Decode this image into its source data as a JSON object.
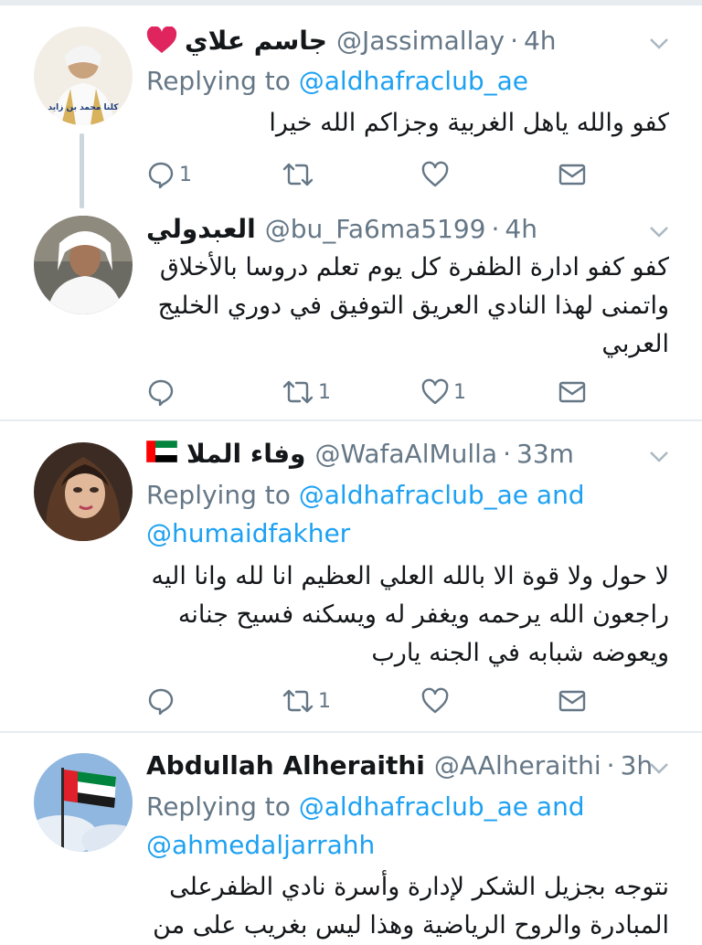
{
  "tweets": [
    {
      "name": "جاسم علاي",
      "handle": "@Jassimallay",
      "time": "4h",
      "reply_prefix": "Replying to",
      "reply_to": "@aldhafraclub_ae",
      "text": "كفو والله ياهل الغربية وجزاكم الله خيرا",
      "counts": {
        "reply": "1",
        "retweet": "",
        "like": ""
      },
      "avatar_caption": "كلنا محمد بن زايد"
    },
    {
      "name": "العبدولي",
      "handle": "@bu_Fa6ma5199",
      "time": "4h",
      "text": "كفو كفو ادارة الظفرة كل يوم تعلم دروسا بالأخلاق واتمنى لهذا النادي العريق التوفيق في دوري الخليج العربي",
      "counts": {
        "reply": "",
        "retweet": "1",
        "like": "1"
      }
    },
    {
      "name": "وفاء الملا",
      "handle": "@WafaAlMulla",
      "time": "33m",
      "reply_prefix": "Replying to",
      "reply_to": "@aldhafraclub_ae",
      "reply_and": "and",
      "reply_to2": "@humaidfakher",
      "text": "لا حول ولا قوة الا بالله العلي العظيم انا لله وانا اليه راجعون الله يرحمه ويغفر له ويسكنه فسيح جنانه ويعوضه شبابه في الجنه يارب",
      "counts": {
        "reply": "",
        "retweet": "1",
        "like": ""
      }
    },
    {
      "name": "Abdullah Alheraithi",
      "handle": "@AAlheraithi",
      "time": "3h",
      "reply_prefix": "Replying to",
      "reply_to": "@aldhafraclub_ae",
      "reply_and": "and",
      "reply_to2": "@ahmedaljarrahh",
      "text": "نتوجه بجزيل الشكر لإدارة وأسرة نادي الظفرعلى المبادرة والروح الرياضية وهذا ليس بغريب على من"
    }
  ],
  "icons": {
    "reply": "reply-icon",
    "retweet": "retweet-icon",
    "like": "heart-icon",
    "dm": "envelope-icon",
    "more": "chevron-down-icon"
  },
  "colors": {
    "link": "#1da1f2",
    "secondary": "#657786",
    "divider": "#e6ecf0",
    "heart": "#e0245e"
  }
}
